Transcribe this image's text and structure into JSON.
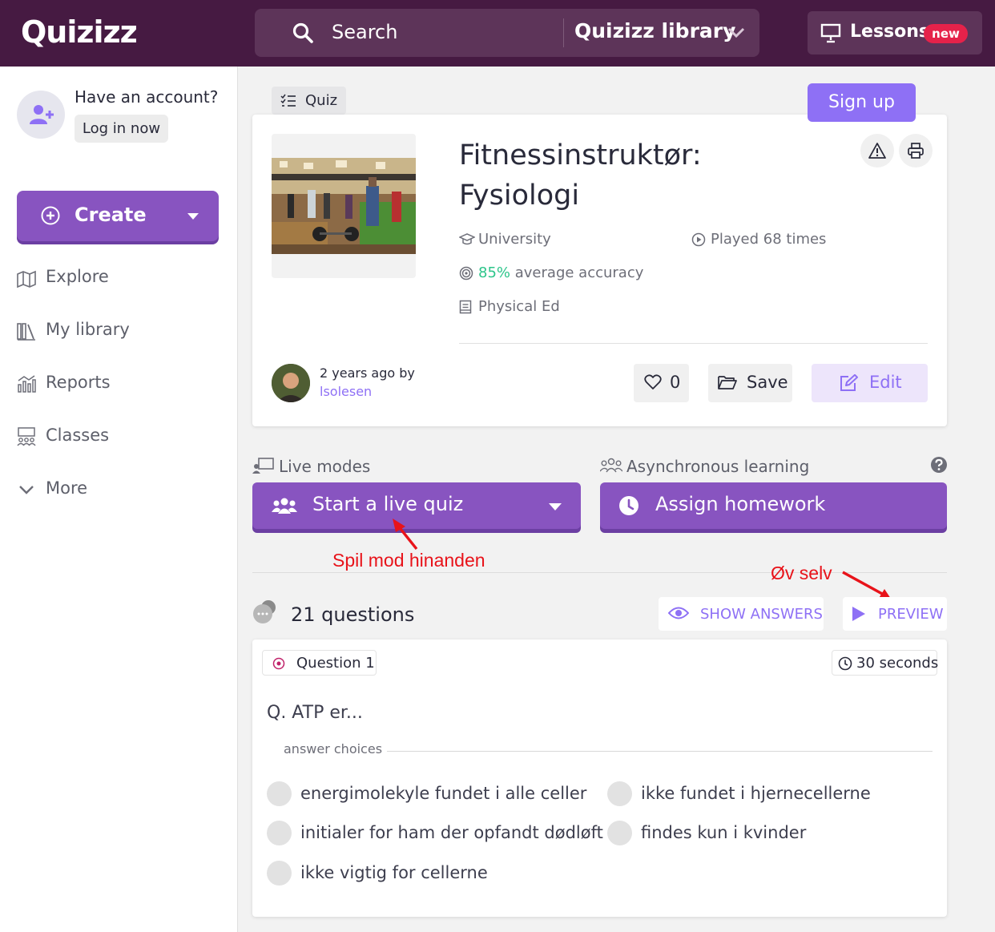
{
  "header": {
    "logo": "Quizizz",
    "search_placeholder": "Search",
    "library_label": "Quizizz library",
    "lessons_label": "Lessons",
    "new_badge": "new"
  },
  "sidebar": {
    "account_question": "Have an account?",
    "login_label": "Log in now",
    "create_label": "Create",
    "nav": [
      {
        "label": "Explore",
        "icon": "map-icon"
      },
      {
        "label": "My library",
        "icon": "library-icon"
      },
      {
        "label": "Reports",
        "icon": "reports-icon"
      },
      {
        "label": "Classes",
        "icon": "classes-icon"
      },
      {
        "label": "More",
        "icon": "chevron-down-icon"
      }
    ]
  },
  "quiz": {
    "type_tag": "Quiz",
    "signup_label": "Sign up",
    "title_line1": "Fitnessinstruktør:",
    "title_line2": "Fysiologi",
    "grade": "University",
    "played": "Played 68 times",
    "accuracy_pct": "85%",
    "accuracy_label": "average accuracy",
    "subject": "Physical Ed",
    "author_ago": "2 years ago by",
    "author_name": "lsolesen",
    "likes": "0",
    "save_label": "Save",
    "edit_label": "Edit"
  },
  "modes": {
    "live_label": "Live modes",
    "async_label": "Asynchronous learning",
    "start_live": "Start a live quiz",
    "assign_homework": "Assign homework"
  },
  "annotations": {
    "live": "Spil mod hinanden",
    "preview": "Øv selv"
  },
  "questions": {
    "count_label": "21 questions",
    "show_answers": "SHOW ANSWERS",
    "preview": "PREVIEW",
    "items": [
      {
        "number_label": "Question 1",
        "time_label": "30 seconds",
        "text": "Q. ATP er...",
        "answer_choices_label": "answer choices",
        "choices": [
          "energimolekyle fundet i alle celler",
          "ikke fundet i hjernecellerne",
          "initialer for ham der opfandt dødløft",
          "findes kun i kvinder",
          "ikke vigtig for cellerne"
        ]
      }
    ]
  },
  "colors": {
    "header_bg": "#461a42",
    "primary_purple": "#8854c0",
    "accent_violet": "#8e70f5",
    "accuracy_green": "#2cc58a",
    "badge_red": "#e5224a",
    "annotation_red": "#e8131a"
  }
}
